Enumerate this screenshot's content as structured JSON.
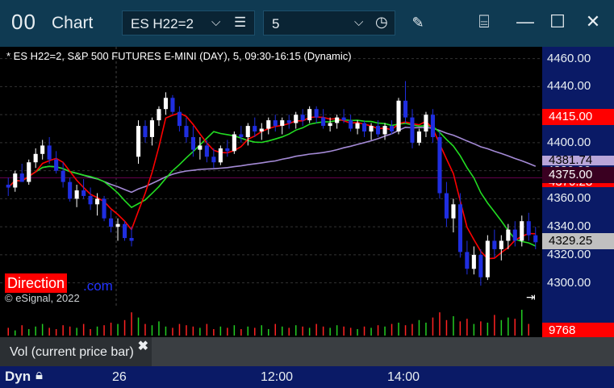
{
  "window": {
    "logo": "00",
    "title": "Chart",
    "symbol_value": "ES H22=2",
    "interval_value": "5",
    "icons": [
      "list-icon",
      "chevron-down-icon",
      "clock-icon",
      "pencil-icon",
      "template-icon",
      "minimize-icon",
      "maximize-icon",
      "close-icon"
    ]
  },
  "chart": {
    "info": "* ES H22=2, S&P 500 FUTURES E-MINI (DAY), 5, 09:30-16:15 (Dynamic)",
    "price_labels": [
      "4460.00",
      "4440.00",
      "4420.00",
      "4400.00",
      "4380.00",
      "4360.00",
      "4340.00",
      "4320.00",
      "4300.00"
    ],
    "tags": [
      {
        "text": "4415.00",
        "bg": "#ff0000",
        "fg": "#ffffff"
      },
      {
        "text": "4381.74",
        "bg": "#b9a6d9",
        "fg": "#000000"
      },
      {
        "text": "4375.00",
        "bg": "#3a0021",
        "fg": "#ffffff"
      },
      {
        "text": "4370.28",
        "bg": "#ff0000",
        "fg": "#ffffff"
      },
      {
        "text": "4329.25",
        "bg": "#c0c0c0",
        "fg": "#000000"
      }
    ],
    "direction_label": "Direction",
    "com_text": ".com",
    "copyright": "© eSignal, 2022"
  },
  "volume": {
    "value_tag": "9768",
    "legend_label": "Vol (current price bar)",
    "close_symbol": "✖"
  },
  "timeaxis": {
    "mode": "Dyn",
    "labels": [
      "26",
      "12:00",
      "14:00"
    ]
  },
  "colors": {
    "up": "#ffffff",
    "down": "#1f2ee0",
    "ma_red": "#ff0000",
    "ma_green": "#22dd22",
    "ma_purple": "#a48ad6"
  },
  "chart_data": {
    "type": "candlestick",
    "ylim": [
      4290,
      4465
    ],
    "candles": [
      [
        4370,
        4375,
        4362,
        4368
      ],
      [
        4368,
        4380,
        4365,
        4378
      ],
      [
        4378,
        4385,
        4372,
        4372
      ],
      [
        4372,
        4388,
        4370,
        4386
      ],
      [
        4386,
        4396,
        4382,
        4392
      ],
      [
        4392,
        4402,
        4388,
        4398
      ],
      [
        4398,
        4404,
        4385,
        4388
      ],
      [
        4388,
        4394,
        4378,
        4380
      ],
      [
        4380,
        4386,
        4368,
        4372
      ],
      [
        4372,
        4375,
        4358,
        4360
      ],
      [
        4360,
        4370,
        4354,
        4366
      ],
      [
        4366,
        4374,
        4360,
        4362
      ],
      [
        4362,
        4368,
        4352,
        4356
      ],
      [
        4356,
        4364,
        4348,
        4360
      ],
      [
        4360,
        4362,
        4344,
        4346
      ],
      [
        4346,
        4352,
        4336,
        4340
      ],
      [
        4340,
        4346,
        4330,
        4342
      ],
      [
        4342,
        4344,
        4330,
        4332
      ],
      [
        4332,
        4340,
        4326,
        4330
      ],
      [
        4390,
        4416,
        4385,
        4412
      ],
      [
        4412,
        4416,
        4400,
        4404
      ],
      [
        4404,
        4418,
        4398,
        4416
      ],
      [
        4416,
        4426,
        4412,
        4424
      ],
      [
        4424,
        4436,
        4420,
        4432
      ],
      [
        4432,
        4434,
        4420,
        4422
      ],
      [
        4422,
        4426,
        4408,
        4412
      ],
      [
        4412,
        4418,
        4400,
        4404
      ],
      [
        4404,
        4412,
        4390,
        4395
      ],
      [
        4395,
        4404,
        4388,
        4398
      ],
      [
        4398,
        4402,
        4386,
        4390
      ],
      [
        4390,
        4396,
        4382,
        4386
      ],
      [
        4386,
        4398,
        4384,
        4396
      ],
      [
        4396,
        4402,
        4390,
        4394
      ],
      [
        4394,
        4408,
        4392,
        4406
      ],
      [
        4406,
        4412,
        4400,
        4404
      ],
      [
        4404,
        4414,
        4398,
        4412
      ],
      [
        4412,
        4418,
        4404,
        4408
      ],
      [
        4408,
        4414,
        4402,
        4410
      ],
      [
        4410,
        4418,
        4406,
        4416
      ],
      [
        4416,
        4420,
        4408,
        4412
      ],
      [
        4412,
        4418,
        4406,
        4416
      ],
      [
        4416,
        4420,
        4410,
        4414
      ],
      [
        4414,
        4422,
        4410,
        4420
      ],
      [
        4420,
        4424,
        4412,
        4416
      ],
      [
        4416,
        4426,
        4414,
        4424
      ],
      [
        4424,
        4426,
        4414,
        4418
      ],
      [
        4418,
        4424,
        4410,
        4412
      ],
      [
        4412,
        4418,
        4408,
        4414
      ],
      [
        4414,
        4420,
        4410,
        4418
      ],
      [
        4418,
        4424,
        4414,
        4416
      ],
      [
        4416,
        4420,
        4408,
        4410
      ],
      [
        4410,
        4416,
        4406,
        4414
      ],
      [
        4414,
        4416,
        4404,
        4408
      ],
      [
        4408,
        4414,
        4402,
        4412
      ],
      [
        4412,
        4416,
        4404,
        4406
      ],
      [
        4406,
        4414,
        4402,
        4412
      ],
      [
        4412,
        4416,
        4406,
        4408
      ],
      [
        4408,
        4432,
        4406,
        4430
      ],
      [
        4430,
        4444,
        4414,
        4418
      ],
      [
        4418,
        4424,
        4396,
        4400
      ],
      [
        4400,
        4410,
        4398,
        4408
      ],
      [
        4408,
        4422,
        4404,
        4420
      ],
      [
        4420,
        4424,
        4400,
        4404
      ],
      [
        4404,
        4408,
        4360,
        4364
      ],
      [
        4364,
        4372,
        4340,
        4346
      ],
      [
        4346,
        4360,
        4336,
        4356
      ],
      [
        4356,
        4364,
        4318,
        4322
      ],
      [
        4322,
        4330,
        4306,
        4310
      ],
      [
        4310,
        4326,
        4306,
        4320
      ],
      [
        4320,
        4324,
        4298,
        4304
      ],
      [
        4304,
        4334,
        4302,
        4330
      ],
      [
        4330,
        4338,
        4318,
        4324
      ],
      [
        4324,
        4334,
        4316,
        4330
      ],
      [
        4330,
        4342,
        4324,
        4338
      ],
      [
        4338,
        4344,
        4326,
        4330
      ],
      [
        4330,
        4348,
        4326,
        4344
      ],
      [
        4344,
        4350,
        4330,
        4334
      ],
      [
        4334,
        4340,
        4324,
        4329
      ]
    ],
    "volumes": [
      6,
      4,
      8,
      5,
      7,
      9,
      6,
      5,
      8,
      7,
      6,
      9,
      5,
      7,
      8,
      10,
      9,
      12,
      18,
      14,
      9,
      8,
      11,
      7,
      6,
      9,
      8,
      7,
      6,
      9,
      5,
      7,
      6,
      8,
      5,
      7,
      6,
      8,
      5,
      9,
      7,
      6,
      8,
      7,
      6,
      9,
      7,
      6,
      8,
      7,
      6,
      5,
      7,
      6,
      8,
      7,
      9,
      10,
      8,
      9,
      12,
      10,
      14,
      18,
      12,
      15,
      11,
      13,
      9,
      11,
      10,
      16,
      12,
      14,
      13,
      20,
      9
    ]
  }
}
